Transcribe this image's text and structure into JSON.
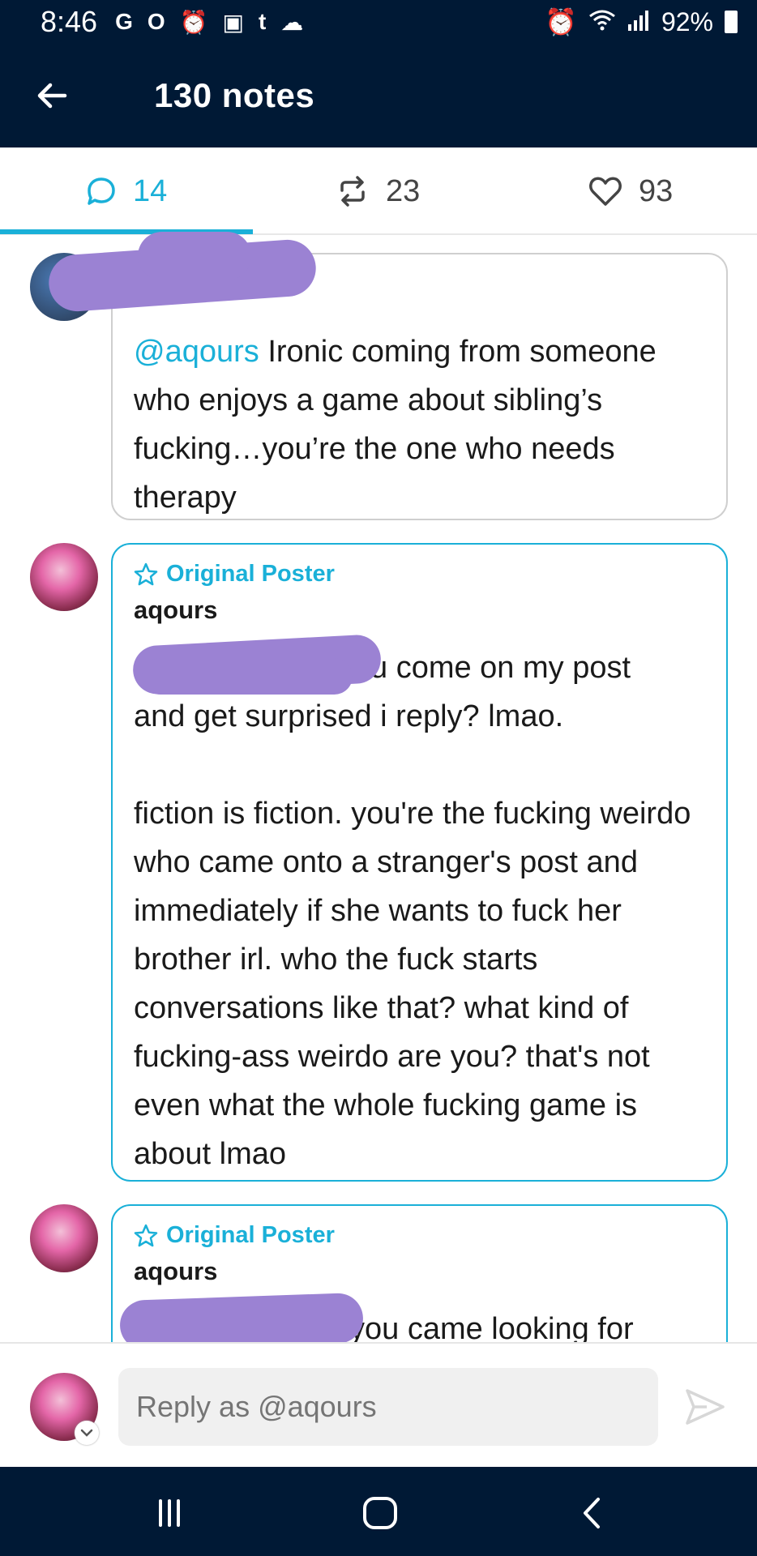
{
  "status_bar": {
    "time": "8:46",
    "battery": "92%",
    "icons": [
      "google-icon",
      "opera-icon",
      "alarm-clock-icon",
      "gallery-icon",
      "tumblr-icon",
      "cloud-icon",
      "alarm-icon",
      "wifi-icon",
      "signal-icon",
      "battery-icon"
    ]
  },
  "header": {
    "title": "130 notes"
  },
  "tabs": [
    {
      "key": "replies",
      "count": "14",
      "icon": "reply-bubble-icon",
      "active": true
    },
    {
      "key": "reblogs",
      "count": "23",
      "icon": "reblog-icon",
      "active": false
    },
    {
      "key": "likes",
      "count": "93",
      "icon": "heart-icon",
      "active": false
    }
  ],
  "notes": [
    {
      "mention": "@aqours",
      "text": " Ironic coming from someone who enjoys a game about sibling’s fucking…you’re the one who needs therapy"
    },
    {
      "op_label": "Original Poster",
      "username": "aqours",
      "text_line1": "u come on my post",
      "text_rest": "and get surprised i reply? lmao.\n\nfiction is fiction. you're the fucking weirdo who came onto a stranger's post and immediately if she wants to fuck her brother irl. who the fuck starts conversations like that? what kind of fucking-ass weirdo are you? that's not even what the whole fucking game is about lmao"
    },
    {
      "op_label": "Original Poster",
      "username": "aqours",
      "text_line1": "you came looking for"
    }
  ],
  "reply": {
    "placeholder": "Reply as @aqours"
  },
  "colors": {
    "header_bg": "#001935",
    "accent": "#1ab0d8",
    "redaction": "#9b82d3"
  }
}
